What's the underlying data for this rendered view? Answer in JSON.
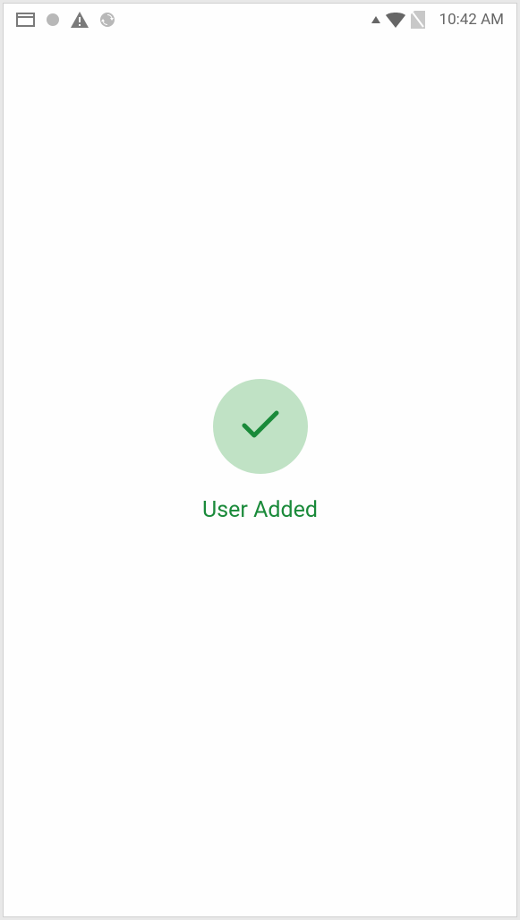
{
  "status_bar": {
    "time": "10:42 AM",
    "icons": {
      "card": "card-icon",
      "dot": "dot-icon",
      "warning": "warning-icon",
      "sync": "sync-icon",
      "triangle": "triangle-up-icon",
      "wifi": "wifi-icon",
      "sim": "no-sim-icon"
    }
  },
  "content": {
    "success_message": "User Added",
    "success_icon": "checkmark-icon",
    "accent_color": "#1a8a3a",
    "circle_bg_color": "#c0e2c5"
  }
}
